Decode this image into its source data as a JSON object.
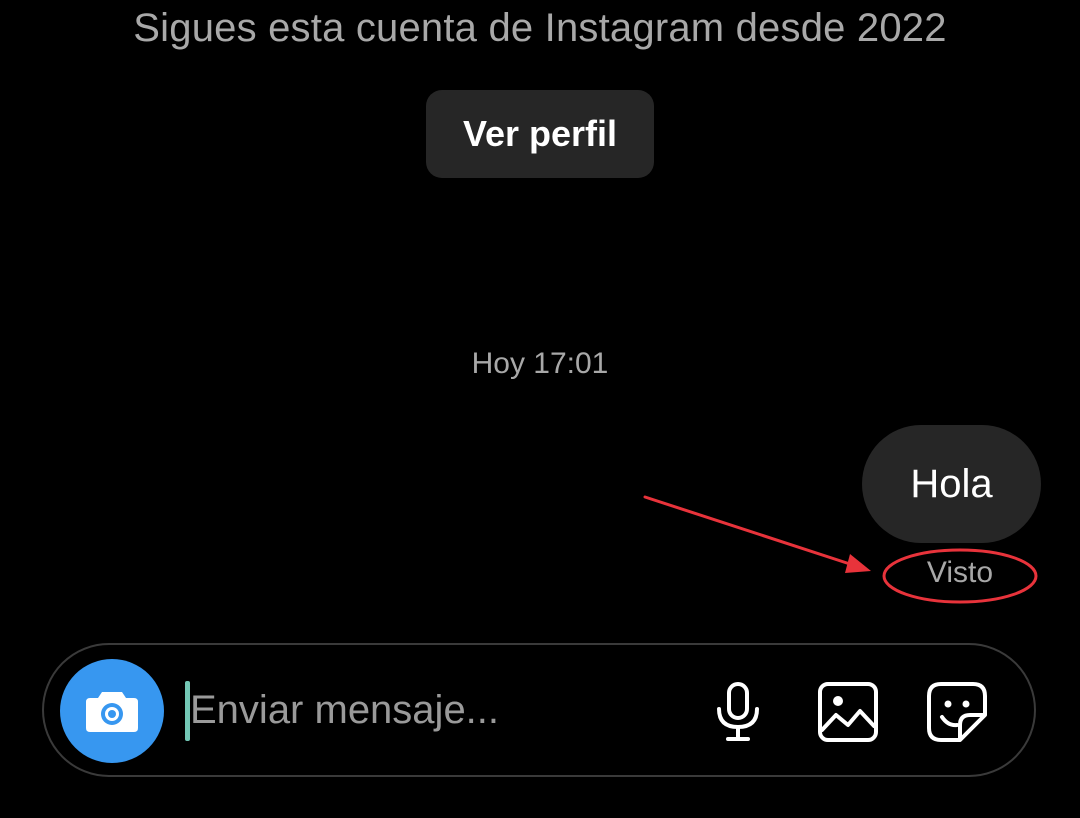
{
  "conversation": {
    "follow_note": "Sigues esta cuenta de Instagram desde 2022",
    "view_profile_label": "Ver perfil",
    "timestamp": "Hoy 17:01",
    "messages": [
      {
        "text": "Hola",
        "sender": "me",
        "status": "Visto"
      }
    ]
  },
  "composer": {
    "placeholder": "Enviar mensaje...",
    "value": "",
    "icons": {
      "camera": "camera-icon",
      "microphone": "microphone-icon",
      "gallery": "image-icon",
      "sticker": "sticker-icon"
    }
  },
  "colors": {
    "background": "#000000",
    "bubble": "#262626",
    "muted_text": "#a8a8a8",
    "camera_button": "#3797f0",
    "annotation": "#e8333b"
  }
}
